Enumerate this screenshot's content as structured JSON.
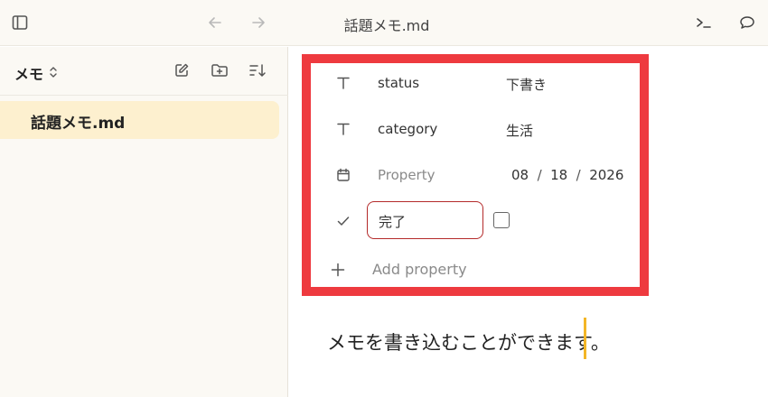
{
  "window": {
    "title": "話題メモ.md"
  },
  "toolbar": {
    "icons": [
      "sidebar-toggle-icon",
      "back-arrow-icon",
      "forward-arrow-icon",
      "terminal-icon",
      "chat-bubble-icon"
    ]
  },
  "sidebar": {
    "vault_name": "メモ",
    "vault_caret": "⌃⌄",
    "actions": [
      "new-note-icon",
      "new-folder-icon",
      "sort-icon"
    ],
    "files": [
      {
        "label": "話題メモ.md",
        "active": true
      }
    ]
  },
  "properties": {
    "rows": [
      {
        "icon": "text-type-icon",
        "key": "status",
        "value": "下書き"
      },
      {
        "icon": "text-type-icon",
        "key": "category",
        "value": "生活"
      },
      {
        "icon": "calendar-icon",
        "key": "Property",
        "date": {
          "month": "08",
          "day": "18",
          "year": "2026",
          "separator": "/"
        }
      },
      {
        "icon": "checkmark-icon",
        "key": "完了",
        "checked": false
      }
    ],
    "add_label": "Add property",
    "border_color": "#ee3a3f"
  },
  "editor": {
    "text": "メモを書き込むことができます。",
    "cursor_color": "#f3b626"
  }
}
